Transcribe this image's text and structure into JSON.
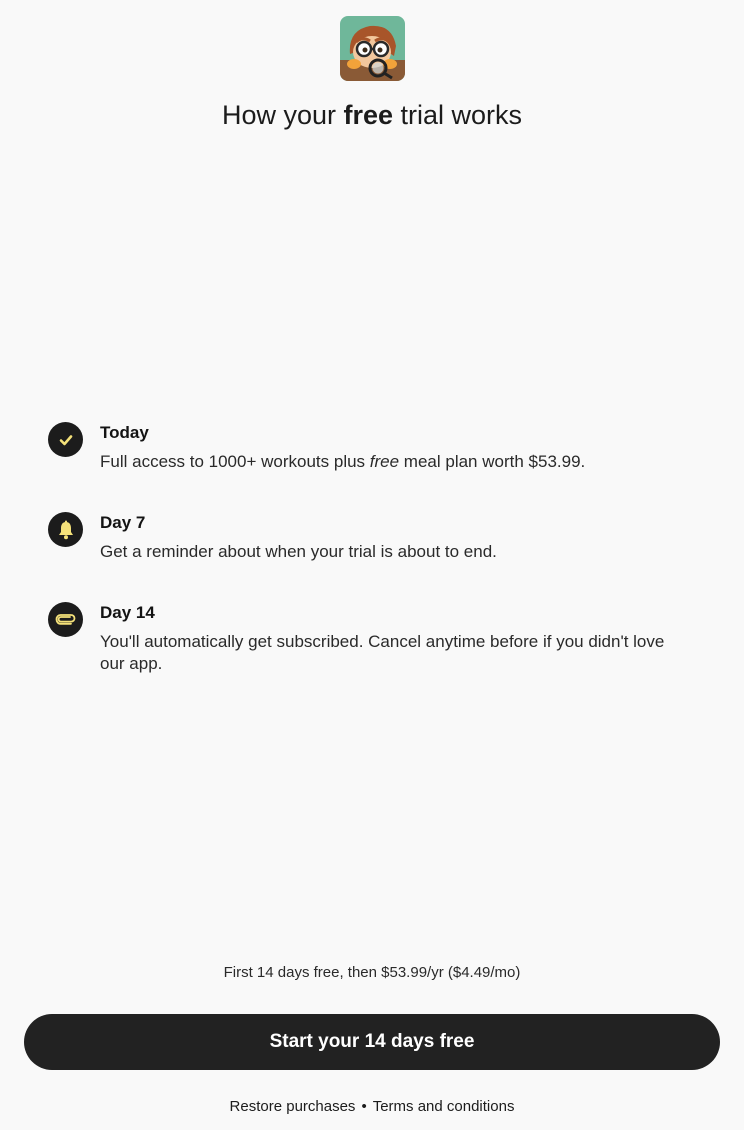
{
  "header": {
    "app_icon": "detective-mascot-icon",
    "title_before": "How your ",
    "title_bold": "free",
    "title_after": " trial works"
  },
  "steps": [
    {
      "icon": "check-icon",
      "title": "Today",
      "desc_before": "Full access to 1000+ workouts plus ",
      "desc_italic": "free",
      "desc_after": " meal plan worth $53.99."
    },
    {
      "icon": "bell-icon",
      "title": "Day 7",
      "desc": "Get a reminder about when your trial is about to end."
    },
    {
      "icon": "paperclip-icon",
      "title": "Day 14",
      "desc": "You'll automatically get subscribed. Cancel anytime before if you didn't love our app."
    }
  ],
  "pricing": {
    "note": "First 14 days free, then $53.99/yr ($4.49/mo)"
  },
  "cta": {
    "label": "Start your 14 days free"
  },
  "footer": {
    "restore_label": "Restore purchases",
    "separator": "•",
    "terms_label": "Terms and conditions"
  },
  "colors": {
    "background": "#f9f9f9",
    "icon_bg": "#1c1c1c",
    "icon_accent": "#f5e27a",
    "cta_bg": "#222222",
    "cta_text": "#ffffff"
  }
}
